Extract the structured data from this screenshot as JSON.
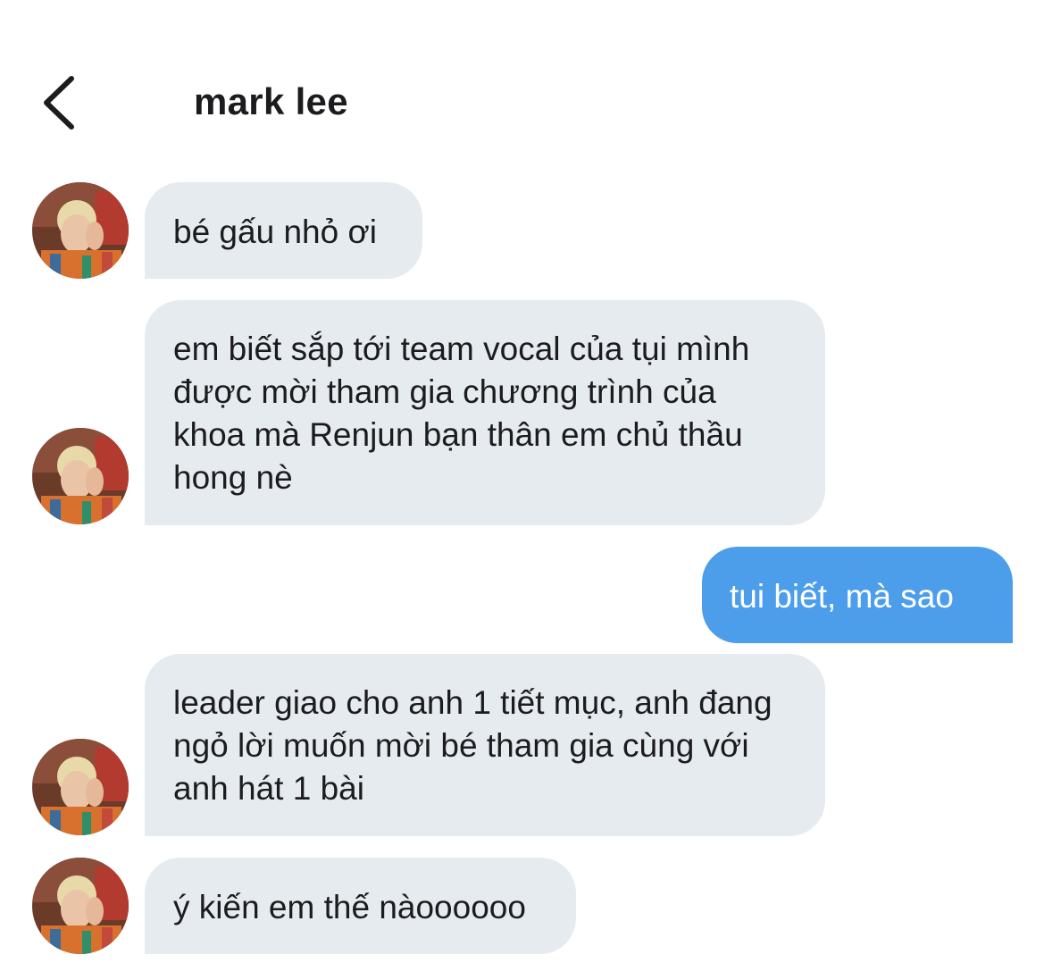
{
  "header": {
    "title": "mark lee",
    "back_icon": "chevron-left-icon"
  },
  "colors": {
    "incoming_bubble": "#e6ebf0",
    "outgoing_bubble": "#4d9eea",
    "text": "#1c1c1e"
  },
  "messages": [
    {
      "sender": "other",
      "text": "bé gấu nhỏ ơi"
    },
    {
      "sender": "other",
      "text": "em biết sắp tới team vocal của tụi mình được mời tham gia chương trình của khoa mà Renjun bạn thân em chủ thầu hong nè"
    },
    {
      "sender": "me",
      "text": "tui biết, mà sao"
    },
    {
      "sender": "other",
      "text": "leader giao cho anh 1 tiết mục, anh đang ngỏ lời muốn mời bé tham gia cùng với anh hát 1 bài"
    },
    {
      "sender": "other",
      "text": "ý kiến em thế nàoooooo"
    }
  ]
}
